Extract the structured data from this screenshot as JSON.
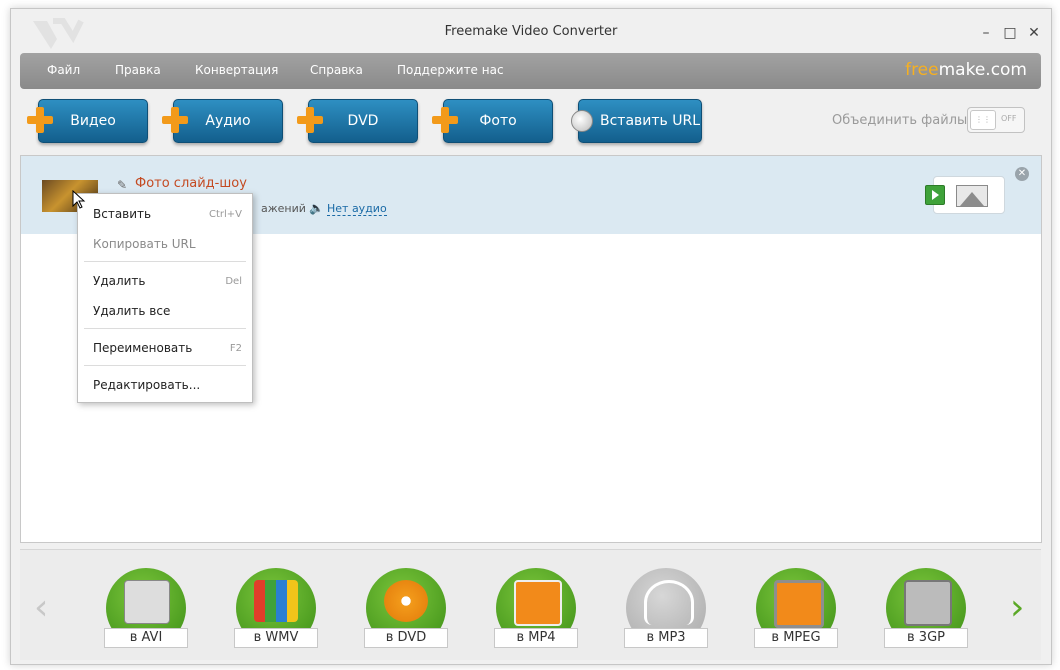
{
  "window": {
    "title": "Freemake Video Converter"
  },
  "controls": {
    "minimize": "–",
    "maximize": "□",
    "close": "✕"
  },
  "menu": {
    "items": [
      "Файл",
      "Правка",
      "Конвертация",
      "Справка",
      "Поддержите нас"
    ],
    "brand_free": "free",
    "brand_rest": "make.com"
  },
  "toolbar": {
    "buttons": [
      "Видео",
      "Аудио",
      "DVD",
      "Фото",
      "Вставить URL"
    ],
    "merge_label": "Объединить файлы",
    "toggle_state": "OFF"
  },
  "file_row": {
    "title": "Фото слайд-шоу",
    "info_fragment": "ажений",
    "audio_link": "Нет аудио"
  },
  "context_menu": {
    "items": [
      {
        "label": "Вставить",
        "shortcut": "Ctrl+V"
      },
      {
        "label": "Копировать URL",
        "shortcut": ""
      },
      {
        "label": "Удалить",
        "shortcut": "Del"
      },
      {
        "label": "Удалить все",
        "shortcut": ""
      },
      {
        "label": "Переименовать",
        "shortcut": "F2"
      },
      {
        "label": "Редактировать...",
        "shortcut": ""
      }
    ]
  },
  "formats": [
    "в AVI",
    "в WMV",
    "в DVD",
    "в MP4",
    "в MP3",
    "в MPEG",
    "в 3GP"
  ],
  "nav": {
    "prev": "‹",
    "next": "›"
  },
  "colors": {
    "accent_blue": "#1b74a8",
    "green": "#5aa825",
    "orange": "#f29a1a",
    "title_red": "#c44a21"
  }
}
